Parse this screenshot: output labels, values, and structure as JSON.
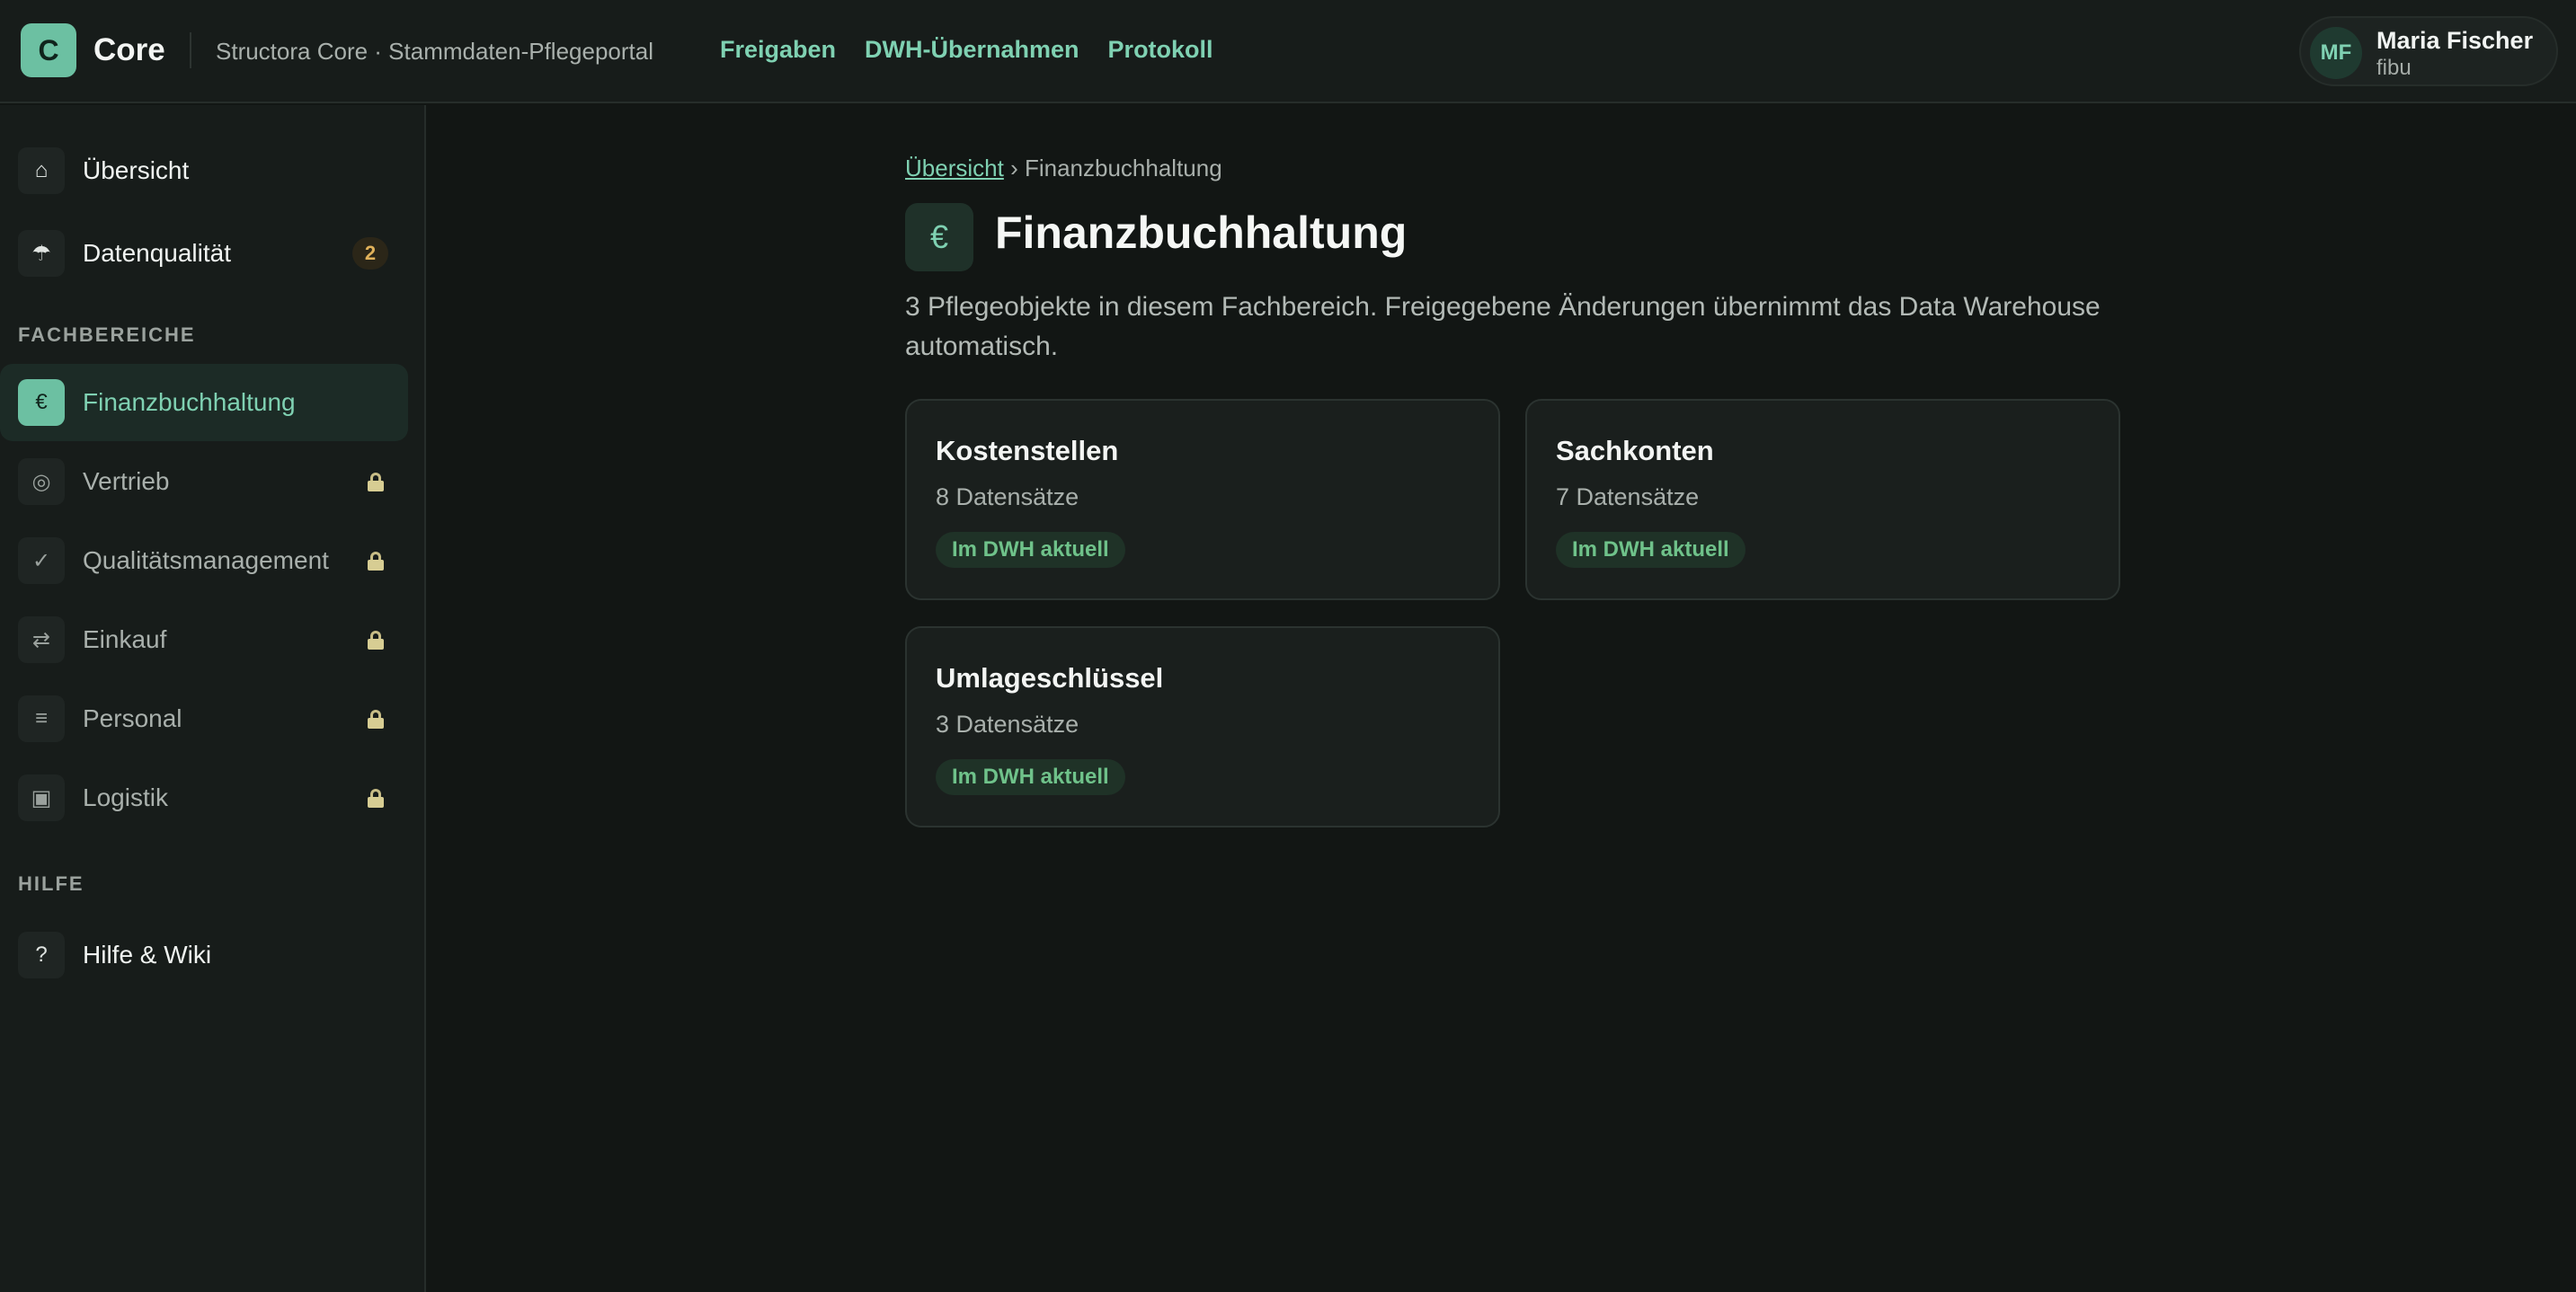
{
  "header": {
    "logo_letter": "C",
    "app_name": "Core",
    "subtitle": "Structora Core · Stammdaten-Pflegeportal",
    "nav": [
      "Freigaben",
      "DWH-Übernahmen",
      "Protokoll"
    ],
    "user": {
      "initials": "MF",
      "name": "Maria Fischer",
      "role": "fibu"
    }
  },
  "sidebar": {
    "top_items": [
      {
        "icon": "⌂",
        "icon_name": "home-icon",
        "label": "Übersicht"
      },
      {
        "icon": "☂",
        "icon_name": "umbrella-icon",
        "label": "Datenqualität",
        "badge": "2"
      }
    ],
    "section_fachbereiche": "FACHBEREICHE",
    "fachbereiche": [
      {
        "icon": "€",
        "icon_name": "euro-icon",
        "label": "Finanzbuchhaltung",
        "active": true
      },
      {
        "icon": "◎",
        "icon_name": "target-icon",
        "label": "Vertrieb",
        "locked": true
      },
      {
        "icon": "✓",
        "icon_name": "check-icon",
        "label": "Qualitätsmanagement",
        "locked": true
      },
      {
        "icon": "⇄",
        "icon_name": "exchange-icon",
        "label": "Einkauf",
        "locked": true
      },
      {
        "icon": "≡",
        "icon_name": "list-icon",
        "label": "Personal",
        "locked": true
      },
      {
        "icon": "▣",
        "icon_name": "box-icon",
        "label": "Logistik",
        "locked": true
      }
    ],
    "section_hilfe": "HILFE",
    "hilfe": [
      {
        "icon": "?",
        "icon_name": "help-icon",
        "label": "Hilfe & Wiki"
      }
    ]
  },
  "main": {
    "breadcrumb": {
      "root": "Übersicht",
      "separator": "›",
      "current": "Finanzbuchhaltung"
    },
    "title_icon": "€",
    "title": "Finanzbuchhaltung",
    "description": "3 Pflegeobjekte in diesem Fachbereich. Freigegebene Änderungen übernimmt das Data Warehouse automatisch.",
    "cards": [
      {
        "title": "Kostenstellen",
        "count": "8 Datensätze",
        "status": "Im DWH aktuell"
      },
      {
        "title": "Sachkonten",
        "count": "7 Datensätze",
        "status": "Im DWH aktuell"
      },
      {
        "title": "Umlageschlüssel",
        "count": "3 Datensätze",
        "status": "Im DWH aktuell"
      }
    ]
  },
  "colors": {
    "accent": "#7fd1b2",
    "accent_solid": "#6cc0a2",
    "status_green": "#6fc28a",
    "badge_amber": "#e0b15a",
    "background": "#121614"
  }
}
